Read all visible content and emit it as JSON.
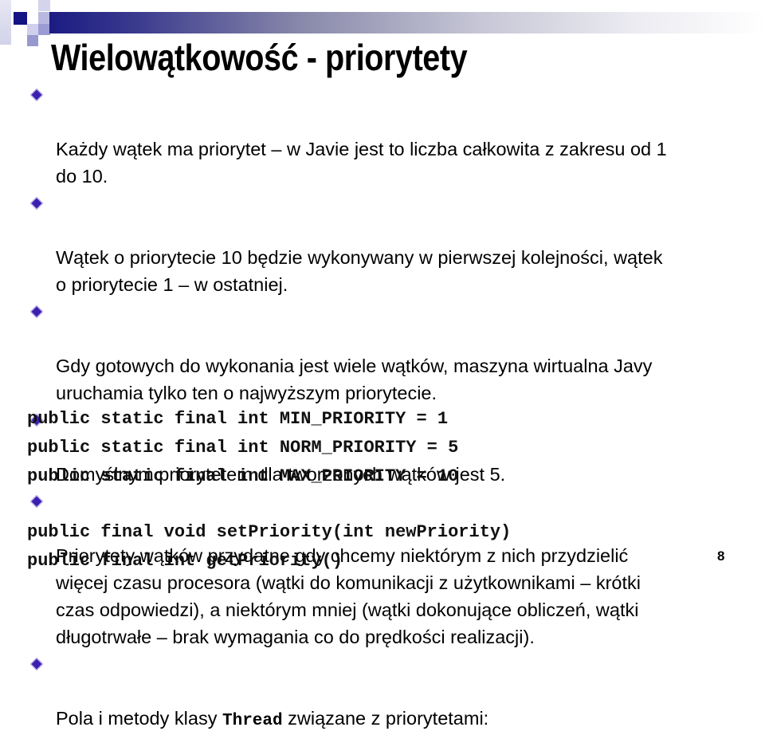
{
  "slide": {
    "title": "Wielowątkowość - priorytety",
    "bullets": [
      {
        "text": "Każdy wątek ma priorytet – w Javie jest to liczba całkowita z zakresu od 1\ndo 10."
      },
      {
        "text": "Wątek o priorytecie 10 będzie wykonywany w pierwszej kolejności, wątek\no priorytecie 1 – w ostatniej."
      },
      {
        "text": "Gdy gotowych do wykonania jest wiele wątków, maszyna wirtualna Javy\nuruchamia tylko ten o najwyższym priorytecie."
      },
      {
        "text": "Domyślnym priorytetem dla tworzonych wątków jest 5."
      },
      {
        "text": "Priorytety wątków przydatne gdy chcemy niektórym z nich przydzielić\nwięcej czasu procesora (wątki do komunikacji z użytkownikami – krótki\nczas odpowiedzi), a niektórym mniej (wątki dokonujące obliczeń, wątki\ndługotrwałe – brak wymagania co do prędkości realizacji)."
      },
      {
        "text_before": "Pola i metody klasy ",
        "code": "Thread",
        "text_after": " związane z priorytetami:"
      }
    ],
    "code_lines": [
      "public static final int MIN_PRIORITY = 1",
      "public static final int NORM_PRIORITY = 5",
      "public static final int MAX_PRIORITY = 10",
      "public final void setPriority(int newPriority)",
      "public final int getPriority()"
    ],
    "page_number": "8",
    "bullet_icon": "diamond-bullet-icon",
    "colors": {
      "accent_navy": "#1b1b83",
      "bullet_fill": "#3d1fb0",
      "logo_light": "#c8c8e8",
      "logo_mid": "#9a9ad0"
    }
  }
}
